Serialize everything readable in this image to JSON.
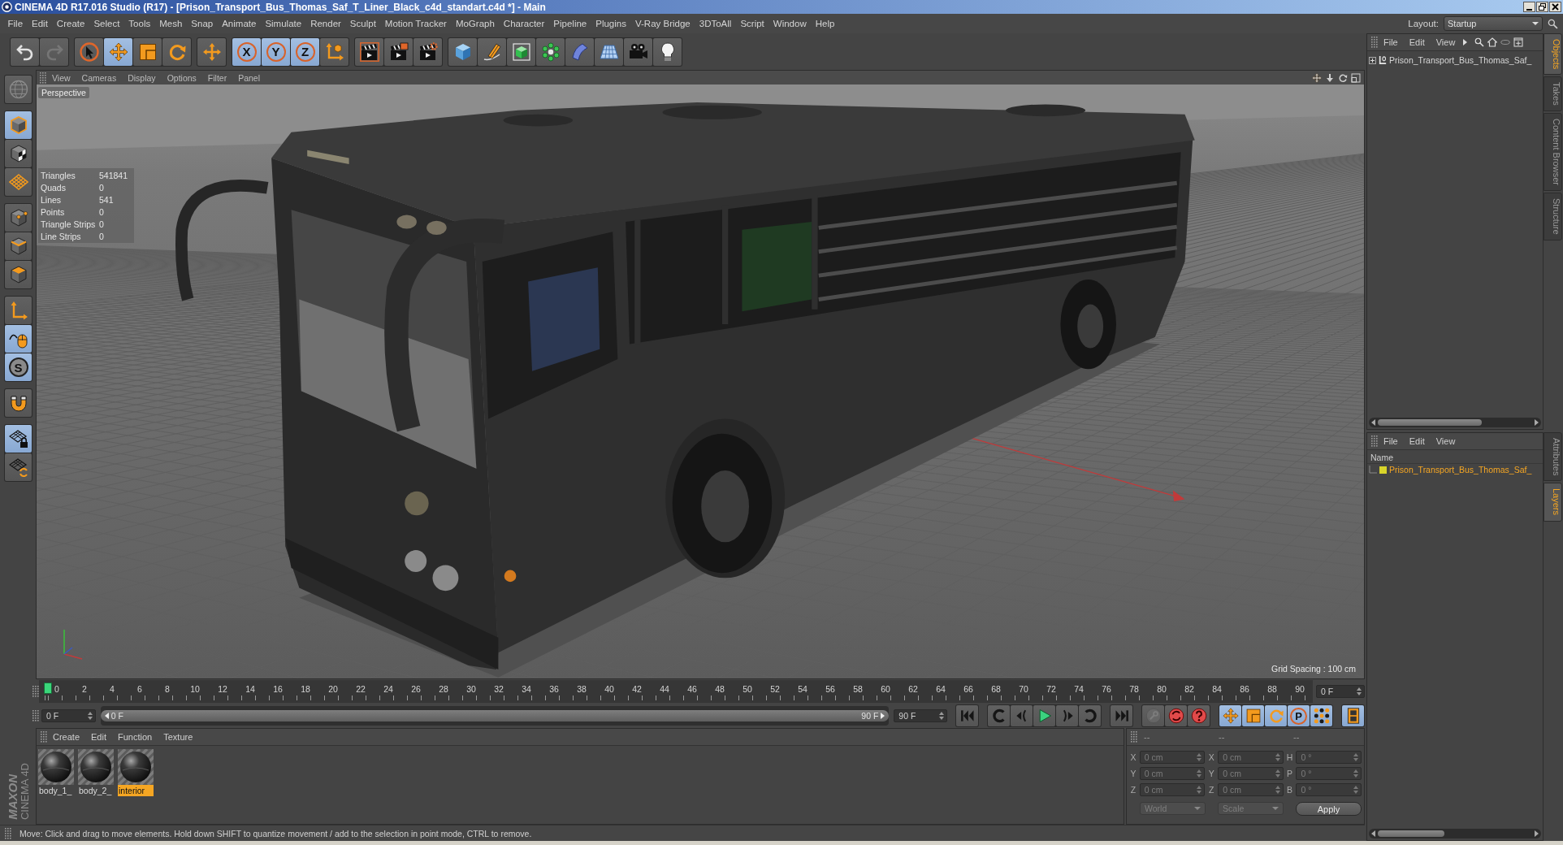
{
  "window": {
    "title": "CINEMA 4D R17.016 Studio (R17) - [Prison_Transport_Bus_Thomas_Saf_T_Liner_Black_c4d_standart.c4d *] - Main"
  },
  "menu_bar": {
    "items": [
      "File",
      "Edit",
      "Create",
      "Select",
      "Tools",
      "Mesh",
      "Snap",
      "Animate",
      "Simulate",
      "Render",
      "Sculpt",
      "Motion Tracker",
      "MoGraph",
      "Character",
      "Pipeline",
      "Plugins",
      "V-Ray Bridge",
      "3DToAll",
      "Script",
      "Window",
      "Help"
    ],
    "layout_label": "Layout:",
    "layout_value": "Startup"
  },
  "toolbar": {
    "groups": [
      [
        {
          "kind": "undo",
          "selected": false,
          "disabled": false
        },
        {
          "kind": "redo",
          "selected": false,
          "disabled": true
        }
      ],
      [
        {
          "kind": "live-select",
          "selected": false,
          "disabled": false
        },
        {
          "kind": "move",
          "selected": true,
          "disabled": false
        },
        {
          "kind": "scale",
          "selected": false,
          "disabled": false
        },
        {
          "kind": "rotate",
          "selected": false,
          "disabled": false
        }
      ],
      [
        {
          "kind": "transform",
          "selected": false,
          "disabled": false
        }
      ],
      [
        {
          "kind": "axis-lock",
          "label": "X",
          "selected": true,
          "disabled": false
        },
        {
          "kind": "axis-lock",
          "label": "Y",
          "selected": true,
          "disabled": false
        },
        {
          "kind": "axis-lock",
          "label": "Z",
          "selected": true,
          "disabled": false
        },
        {
          "kind": "coord-system",
          "selected": false,
          "disabled": false
        }
      ],
      [
        {
          "kind": "render-view",
          "selected": false,
          "disabled": false
        },
        {
          "kind": "render-picture",
          "selected": false,
          "disabled": false
        },
        {
          "kind": "render-settings",
          "selected": false,
          "disabled": false
        }
      ],
      [
        {
          "kind": "cube",
          "selected": false,
          "disabled": false
        },
        {
          "kind": "pen",
          "selected": false,
          "disabled": false
        },
        {
          "kind": "subdivision",
          "selected": false,
          "disabled": false
        },
        {
          "kind": "cloner",
          "selected": false,
          "disabled": false
        },
        {
          "kind": "bend",
          "selected": false,
          "disabled": false
        },
        {
          "kind": "floor",
          "selected": false,
          "disabled": false
        },
        {
          "kind": "camera",
          "selected": false,
          "disabled": false
        },
        {
          "kind": "light",
          "selected": false,
          "disabled": false
        }
      ]
    ]
  },
  "tool_palette": {
    "groups": [
      [
        {
          "kind": "camera-globe",
          "selected": false,
          "disabled": true
        }
      ],
      [
        {
          "kind": "model",
          "selected": true,
          "disabled": false
        },
        {
          "kind": "texture",
          "selected": false,
          "disabled": false
        },
        {
          "kind": "workplane",
          "selected": false,
          "disabled": false
        }
      ],
      [
        {
          "kind": "points",
          "selected": false,
          "disabled": false
        },
        {
          "kind": "edges",
          "selected": false,
          "disabled": false
        },
        {
          "kind": "polygons",
          "selected": false,
          "disabled": false
        }
      ],
      [
        {
          "kind": "axis",
          "selected": false,
          "disabled": false
        },
        {
          "kind": "tweak",
          "selected": true,
          "disabled": false
        },
        {
          "kind": "solo",
          "label": "S",
          "selected": true,
          "disabled": false
        }
      ],
      [
        {
          "kind": "snap",
          "selected": false,
          "disabled": false
        }
      ],
      [
        {
          "kind": "lock-workplane",
          "selected": true,
          "disabled": false
        },
        {
          "kind": "planar-workplane",
          "selected": false,
          "disabled": false
        }
      ]
    ]
  },
  "viewport": {
    "menu": [
      "View",
      "Cameras",
      "Display",
      "Options",
      "Filter",
      "Panel"
    ],
    "camera": "Perspective",
    "stats": [
      {
        "label": "Triangles",
        "value": "541841"
      },
      {
        "label": "Quads",
        "value": "0"
      },
      {
        "label": "Lines",
        "value": "541"
      },
      {
        "label": "Points",
        "value": "0"
      },
      {
        "label": "Triangle Strips",
        "value": "0"
      },
      {
        "label": "Line Strips",
        "value": "0"
      }
    ],
    "grid_spacing": "Grid Spacing : 100 cm"
  },
  "objects_panel": {
    "menu": [
      "File",
      "Edit",
      "View"
    ],
    "items": [
      {
        "name": "Prison_Transport_Bus_Thomas_Saf_",
        "expanded": false
      }
    ]
  },
  "layers_panel": {
    "menu": [
      "File",
      "Edit",
      "View"
    ],
    "column": "Name",
    "items": [
      {
        "name": "Prison_Transport_Bus_Thomas_Saf_",
        "color": "#d8d42a",
        "selected": true
      }
    ]
  },
  "side_tabs": {
    "top": [
      {
        "label": "Objects",
        "selected": true
      },
      {
        "label": "Takes",
        "selected": false
      },
      {
        "label": "Content Browser",
        "selected": false
      },
      {
        "label": "Structure",
        "selected": false
      }
    ],
    "bottom": [
      {
        "label": "Attributes",
        "selected": false
      },
      {
        "label": "Layers",
        "selected": true
      }
    ]
  },
  "timeline": {
    "ticks": [
      "0",
      "2",
      "4",
      "6",
      "8",
      "10",
      "12",
      "14",
      "16",
      "18",
      "20",
      "22",
      "24",
      "26",
      "28",
      "30",
      "32",
      "34",
      "36",
      "38",
      "40",
      "42",
      "44",
      "46",
      "48",
      "50",
      "52",
      "54",
      "56",
      "58",
      "60",
      "62",
      "64",
      "66",
      "68",
      "70",
      "72",
      "74",
      "76",
      "78",
      "80",
      "82",
      "84",
      "86",
      "88",
      "90"
    ],
    "level": 0,
    "current_frame": "0 F"
  },
  "transport": {
    "start_field": "0 F",
    "range": {
      "start": "0 F",
      "end": "90 F",
      "level": 1
    },
    "end_field": "90 F",
    "playback": [
      [
        {
          "kind": "go-start"
        }
      ],
      [
        {
          "kind": "prev-key"
        },
        {
          "kind": "prev-frame"
        },
        {
          "kind": "play"
        },
        {
          "kind": "next-frame"
        },
        {
          "kind": "next-key"
        }
      ],
      [
        {
          "kind": "go-end"
        }
      ]
    ],
    "keys": [
      [
        {
          "kind": "key-record",
          "selected": false,
          "disabled": true
        },
        {
          "kind": "auto-key",
          "selected": false,
          "disabled": false
        },
        {
          "kind": "key-selection",
          "selected": false,
          "disabled": false
        }
      ],
      [
        {
          "kind": "key-position",
          "selected": true,
          "disabled": false
        },
        {
          "kind": "key-scale",
          "selected": true,
          "disabled": false
        },
        {
          "kind": "key-rotation",
          "selected": true,
          "disabled": false
        },
        {
          "kind": "key-parameter",
          "label": "P",
          "selected": true,
          "disabled": false
        },
        {
          "kind": "key-point-level",
          "selected": true,
          "disabled": false
        }
      ],
      [
        {
          "kind": "timeline-window",
          "selected": true,
          "disabled": false
        }
      ]
    ]
  },
  "materials": {
    "menu": [
      "Create",
      "Edit",
      "Function",
      "Texture"
    ],
    "items": [
      {
        "name": "body_1_",
        "selected": false
      },
      {
        "name": "body_2_",
        "selected": false
      },
      {
        "name": "interior",
        "selected": true
      }
    ]
  },
  "coordinates": {
    "headers": [
      "--",
      "--",
      "--"
    ],
    "rows": [
      {
        "position_axis": "X",
        "position": "0 cm",
        "size_axis": "X",
        "size": "0 cm",
        "rotation_axis": "H",
        "rotation": "0 °"
      },
      {
        "position_axis": "Y",
        "position": "0 cm",
        "size_axis": "Y",
        "size": "0 cm",
        "rotation_axis": "P",
        "rotation": "0 °"
      },
      {
        "position_axis": "Z",
        "position": "0 cm",
        "size_axis": "Z",
        "size": "0 cm",
        "rotation_axis": "B",
        "rotation": "0 °"
      }
    ],
    "mode": "World",
    "size_mode": "Scale",
    "apply": "Apply"
  },
  "logo": {
    "brand": "MAXON",
    "product": "CINEMA 4D"
  },
  "status_bar": {
    "message": "Move: Click and drag to move elements. Hold down SHIFT to quantize movement / add to the selection in point mode, CTRL to remove."
  }
}
